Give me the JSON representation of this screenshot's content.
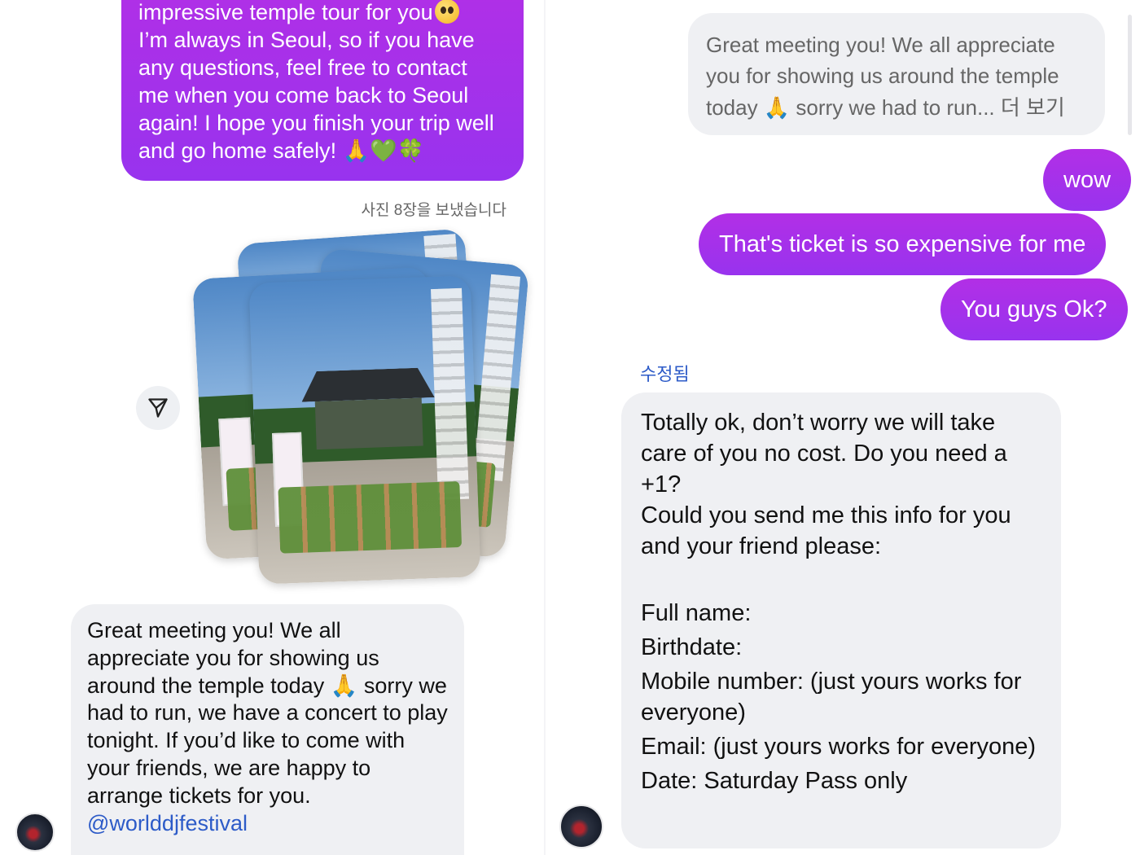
{
  "left_chat": {
    "sent_message_1": {
      "lines": [
        "impressive temple tour for you",
        " I’m always in Seoul, so if you have",
        "any questions, feel free to contact",
        "me when you come back to Seoul",
        "again! I hope you finish your trip well",
        "and go home safely!"
      ],
      "emoji_face": "pleading-face",
      "emoji_trail": "🙏💚🍀"
    },
    "photo_caption": "사진 8장을 보냈습니다",
    "share_icon": "paper-plane-icon",
    "received_message_1": {
      "text": "Great meeting you! We all appreciate you for showing us around the temple today 🙏 sorry we had to run, we have a concert to play tonight. If you’d like to come with your friends, we are happy to arrange tickets for you.",
      "mention": "@worlddjfestival"
    }
  },
  "right_chat": {
    "quoted_message": {
      "line1": "Great meeting you! We all appreciate",
      "line2": "you for showing us around the temple",
      "line3": "today 🙏 sorry we had to run... 더 보기"
    },
    "sent_messages": [
      "wow",
      "That's ticket is so expensive for me",
      "You guys Ok?"
    ],
    "edited_label": "수정됨",
    "received_message_2": {
      "paragraph1": "Totally ok, don’t worry we will take care of you no cost. Do you need a +1?",
      "paragraph2": "Could you send me this info for you and your friend please:",
      "fields": [
        "Full name:",
        "Birthdate:",
        "Mobile number: (just yours works for everyone)",
        "Email: (just yours works for everyone)",
        "Date: Saturday Pass only"
      ]
    }
  },
  "colors": {
    "sent_bubble": "#9e33ee",
    "received_bubble": "#eff0f3",
    "mention_link": "#2d5bc8",
    "edited_label": "#2d5bc8"
  }
}
